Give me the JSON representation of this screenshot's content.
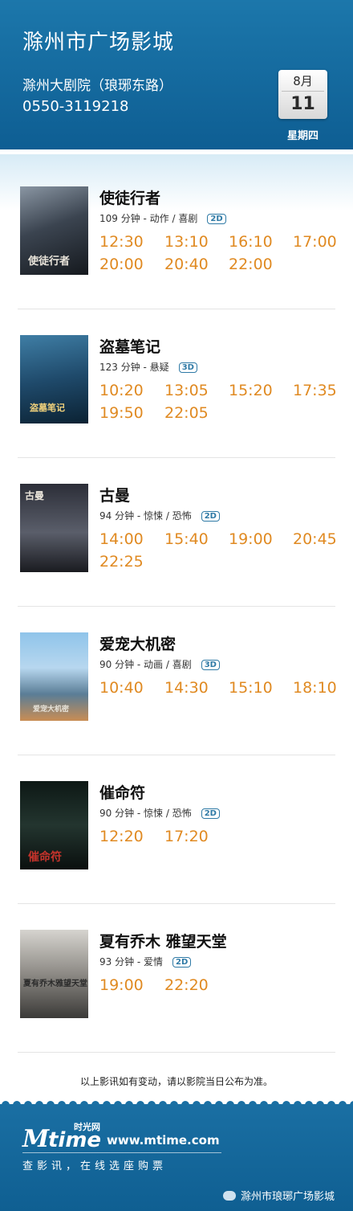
{
  "header": {
    "title": "滁州市广场影城",
    "address": "滁州大剧院（琅琊东路）",
    "phone": "0550-3119218",
    "date_month": "8月",
    "date_day": "11",
    "weekday": "星期四"
  },
  "colors": {
    "header_blue": "#0e5e93",
    "time_orange": "#e08a22",
    "badge_blue": "#2f7aa6"
  },
  "movies": [
    {
      "title": "使徒行者",
      "meta": "109 分钟 - 动作 / 喜剧",
      "format": "2D",
      "poster_text": "使徒行者",
      "times": [
        "12:30",
        "13:10",
        "16:10",
        "17:00",
        "20:00",
        "20:40",
        "22:00"
      ]
    },
    {
      "title": "盗墓笔记",
      "meta": "123  分钟 - 悬疑",
      "format": "3D",
      "poster_text": "盗墓笔记",
      "times": [
        "10:20",
        "13:05",
        "15:20",
        "17:35",
        "19:50",
        "22:05"
      ]
    },
    {
      "title": "古曼",
      "meta": "94 分钟 - 惊悚 / 恐怖",
      "format": "2D",
      "poster_text": "古曼",
      "times": [
        "14:00",
        "15:40",
        "19:00",
        "20:45",
        "22:25"
      ]
    },
    {
      "title": "爱宠大机密",
      "meta": "90  分钟 - 动画 / 喜剧",
      "format": "3D",
      "poster_text": "爱宠大机密",
      "times": [
        "10:40",
        "14:30",
        "15:10",
        "18:10"
      ]
    },
    {
      "title": "催命符",
      "meta": "90 分钟 - 惊悚 / 恐怖",
      "format": "2D",
      "poster_text": "催命符",
      "times": [
        "12:20",
        "17:20"
      ]
    },
    {
      "title": "夏有乔木 雅望天堂",
      "meta": "93 分钟 - 爱情",
      "format": "2D",
      "poster_text": "夏有乔木雅望天堂",
      "times": [
        "19:00",
        "22:20"
      ]
    }
  ],
  "notice": "以上影讯如有变动，请以影院当日公布为准。",
  "footer": {
    "logo_m": "M",
    "logo_time": "time",
    "logo_cn": "时光网",
    "site": "www.mtime.com",
    "tagline": "查影讯，在线选座购票",
    "wechat": "滁州市琅琊广场影城"
  }
}
